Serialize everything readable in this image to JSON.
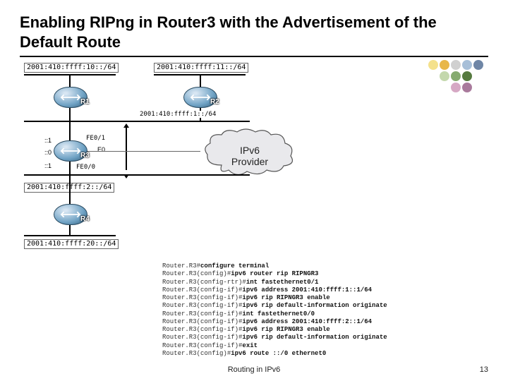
{
  "title": "Enabling RIPng in Router3 with the Advertisement of the Default Route",
  "logo_colors": [
    "#f9e27a",
    "#efb93e",
    "#d4d4d4",
    "#9cb8d6",
    "#6f86a6",
    "#b7cf9a",
    "#6f9a58",
    "#d28bb4",
    "#a86f97"
  ],
  "networks": {
    "n1": "2001:410:ffff:10::/64",
    "n2": "2001:410:ffff:11::/64",
    "n3": "2001:410:ffff:1::/64",
    "n4": "2001:410:ffff:2::/64",
    "n5": "2001:410:ffff:20::/64"
  },
  "routers": {
    "r1": "R1",
    "r2": "R2",
    "r3": "R3",
    "r4": "R4"
  },
  "ifaces": {
    "r3_up": "FE0/1",
    "r3_down": "FE0/0",
    "r3_addr_up": "::1",
    "r3_addr_mid": "::0",
    "r3_addr_down": "::1"
  },
  "cloud": "IPv6\nProvider",
  "cli": {
    "l1p": "Router.R3#",
    "l1c": "configure terminal",
    "l2p": "Router.R3(config)#",
    "l2c": "ipv6 router rip RIPNGR3",
    "l3p": "Router.R3(config-rtr)#",
    "l3c": "int fastethernet0/1",
    "l4p": "Router.R3(config-if)#",
    "l4c": "ipv6 address 2001:410:ffff:1::1/64",
    "l5p": "Router.R3(config-if)#",
    "l5c": "ipv6 rip RIPNGR3 enable",
    "l6p": "Router.R3(config-if)#",
    "l6c": "ipv6 rip default-information originate",
    "l7p": "Router.R3(config-if)#",
    "l7c": "int fastethernet0/0",
    "l8p": "Router.R3(config-if)#",
    "l8c": "ipv6 address 2001:410:ffff:2::1/64",
    "l9p": "Router.R3(config-if)#",
    "l9c": "ipv6 rip RIPNGR3 enable",
    "l10p": "Router.R3(config-if)#",
    "l10c": "ipv6 rip default-information originate",
    "l11p": "Router.R3(config-if)#",
    "l11c": "exit",
    "l12p": "Router.R3(config)#",
    "l12c": "ipv6 route ::/0 ethernet0"
  },
  "footer": "Routing in IPv6",
  "page": "13"
}
